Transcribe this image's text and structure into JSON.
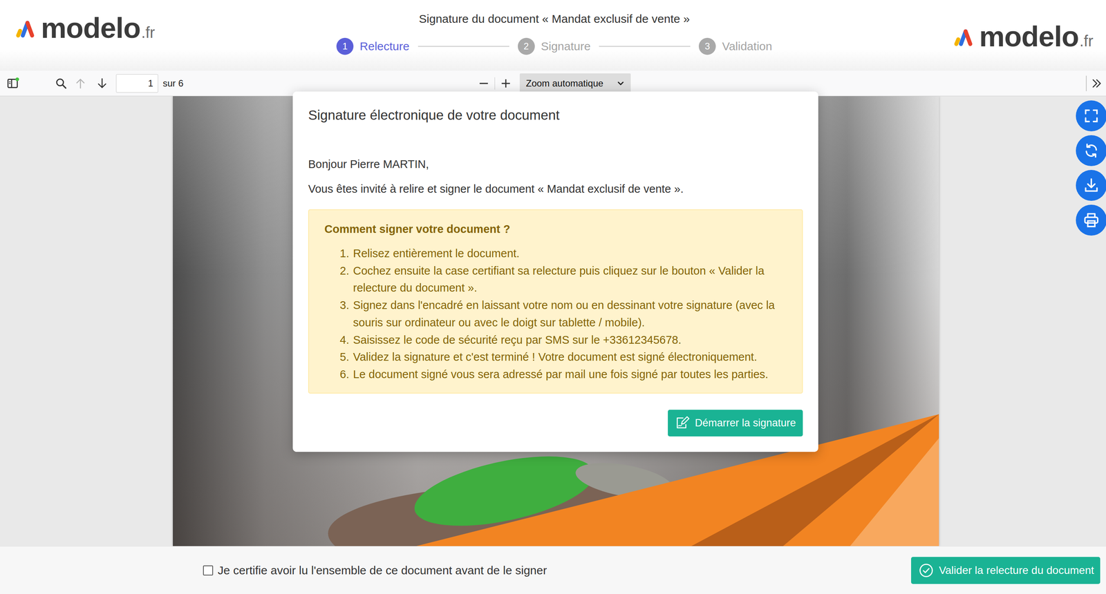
{
  "header": {
    "title": "Signature du document « Mandat exclusif de vente »",
    "logo": {
      "name": "modelo",
      "suffix": ".fr"
    },
    "steps": [
      {
        "number": "1",
        "label": "Relecture",
        "selected": true
      },
      {
        "number": "2",
        "label": "Signature",
        "selected": false
      },
      {
        "number": "3",
        "label": "Validation",
        "selected": false
      }
    ]
  },
  "toolbar": {
    "page": "1",
    "page_count": "sur 6",
    "zoom": "Zoom automatique",
    "nav": [
      {
        "kind": "up",
        "disabled": true
      },
      {
        "kind": "down",
        "disabled": false
      }
    ]
  },
  "modal": {
    "title": "Signature électronique de votre document",
    "greeting": "Bonjour Pierre MARTIN,",
    "intro": "Vous êtes invité à relire et signer le document « Mandat exclusif de vente ».",
    "help": {
      "title": "Comment signer votre document ?",
      "steps": [
        {
          "number": "1.",
          "text": "Relisez entièrement le document."
        },
        {
          "number": "2.",
          "text": "Cochez ensuite la case certifiant sa relecture puis cliquez sur le bouton « Valider la relecture du document »."
        },
        {
          "number": "3.",
          "text": "Signez dans l'encadré en laissant votre nom ou en dessinant votre signature (avec la souris sur ordinateur ou avec le doigt sur tablette / mobile)."
        },
        {
          "number": "4.",
          "text": "Saisissez le code de sécurité reçu par SMS sur le +33612345678."
        },
        {
          "number": "5.",
          "text": "Validez la signature et c'est terminé ! Votre document est signé électroniquement."
        },
        {
          "number": "6.",
          "text": "Le document signé vous sera adressé par mail une fois signé par toutes les parties."
        }
      ]
    },
    "button": "Démarrer la signature"
  },
  "footer": {
    "checkbox": {
      "label": "Je certifie avoir lu l'ensemble de ce document avant de le signer",
      "checked": false
    },
    "button": "Valider la relecture du document"
  }
}
